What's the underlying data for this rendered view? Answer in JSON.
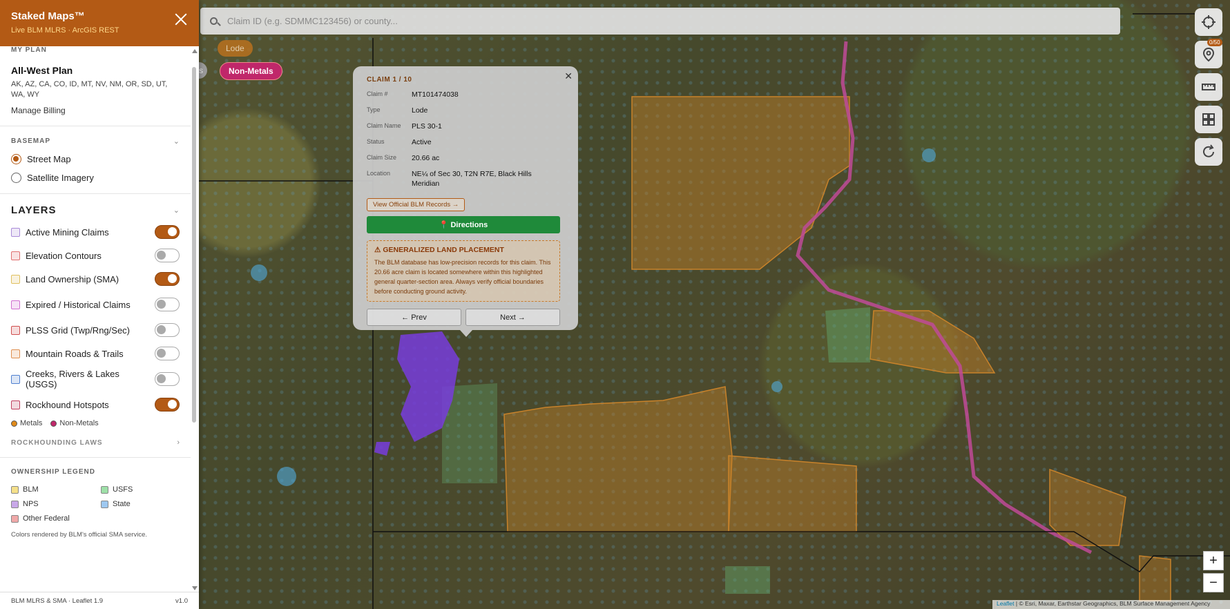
{
  "sidebar": {
    "title": "Staked Maps™",
    "subtitle": "Live BLM MLRS · ArcGIS REST",
    "my_plan_label": "MY PLAN",
    "plan_name": "All-West Plan",
    "plan_states": "AK, AZ, CA, CO, ID, MT, NV, NM, OR, SD, UT, WA, WY",
    "manage_billing": "Manage Billing",
    "basemap_label": "BASEMAP",
    "basemap_options": [
      {
        "label": "Street Map",
        "selected": true
      },
      {
        "label": "Satellite Imagery",
        "selected": false
      }
    ],
    "layers_title": "LAYERS",
    "layers": [
      {
        "label": "Active Mining Claims",
        "on": true,
        "color": "#a98bd8"
      },
      {
        "label": "Elevation Contours",
        "on": false,
        "color": "#e07070"
      },
      {
        "label": "Land Ownership (SMA)",
        "on": true,
        "color": "#e0c060"
      },
      {
        "label": "Expired / Historical Claims",
        "on": false,
        "color": "#d070d0"
      },
      {
        "label": "PLSS Grid (Twp/Rng/Sec)",
        "on": false,
        "color": "#d05050"
      },
      {
        "label": "Mountain Roads & Trails",
        "on": false,
        "color": "#e09050"
      },
      {
        "label": "Creeks, Rivers & Lakes (USGS)",
        "on": false,
        "color": "#5080d0"
      },
      {
        "label": "Rockhound Hotspots",
        "on": true,
        "color": "#c04060"
      }
    ],
    "hotspot_legend": [
      {
        "label": "Metals",
        "color": "#e08a1a"
      },
      {
        "label": "Non-Metals",
        "color": "#c0276a"
      }
    ],
    "rockhounding_laws": "ROCKHOUNDING LAWS",
    "ownership_legend_label": "OWNERSHIP LEGEND",
    "ownership": [
      {
        "label": "BLM",
        "color": "#f5e08a"
      },
      {
        "label": "USFS",
        "color": "#9ee0a8"
      },
      {
        "label": "NPS",
        "color": "#c8a8e8"
      },
      {
        "label": "State",
        "color": "#9ec8f0"
      },
      {
        "label": "Other Federal",
        "color": "#f0a8a8"
      }
    ],
    "ownership_note": "Colors rendered by BLM's official SMA service.",
    "footer_left": "BLM MLRS & SMA · Leaflet 1.9",
    "footer_right": "v1.0"
  },
  "search": {
    "placeholder": "Claim ID (e.g. SDMMC123456) or county..."
  },
  "chips": {
    "lode": "Lode",
    "partial": "s",
    "non_metals": "Non-Metals"
  },
  "popup": {
    "title": "CLAIM 1 / 10",
    "fields": [
      {
        "key": "Claim #",
        "value": "MT101474038"
      },
      {
        "key": "Type",
        "value": "Lode"
      },
      {
        "key": "Claim Name",
        "value": "PLS 30-1"
      },
      {
        "key": "Status",
        "value": "Active"
      },
      {
        "key": "Claim Size",
        "value": "20.66 ac"
      },
      {
        "key": "Location",
        "value": "NE¼ of Sec 30, T2N R7E, Black Hills Meridian"
      }
    ],
    "records_button": "View Official BLM Records →",
    "directions_button": "📍 Directions",
    "warning_title": "GENERALIZED LAND PLACEMENT",
    "warning_text": "The BLM database has low-precision records for this claim. This 20.66 acre claim is located somewhere within this highlighted general quarter-section area. Always verify official boundaries before conducting ground activity.",
    "prev": "← Prev",
    "next": "Next →"
  },
  "controls": {
    "claims_badge": "0/50",
    "zoom_in": "+",
    "zoom_out": "−"
  },
  "attribution": {
    "leaflet": "Leaflet",
    "text": " | © Esri, Maxar, Earthstar Geographics, BLM Surface Management Agency"
  }
}
